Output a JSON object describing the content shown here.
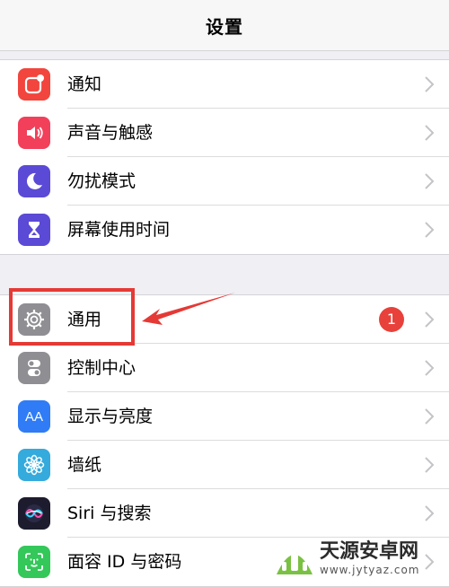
{
  "nav": {
    "title": "设置"
  },
  "group1": [
    {
      "label": "通知",
      "icon": "notification-icon",
      "color": "#f2453d"
    },
    {
      "label": "声音与触感",
      "icon": "speaker-icon",
      "color": "#f2405a"
    },
    {
      "label": "勿扰模式",
      "icon": "moon-icon",
      "color": "#5b4ad6"
    },
    {
      "label": "屏幕使用时间",
      "icon": "hourglass-icon",
      "color": "#5b4ad6"
    }
  ],
  "group2": [
    {
      "label": "通用",
      "icon": "gear-icon",
      "color": "#8e8e93",
      "badge": "1"
    },
    {
      "label": "控制中心",
      "icon": "toggle-icon",
      "color": "#8e8e93"
    },
    {
      "label": "显示与亮度",
      "icon": "text-size-icon",
      "color": "#2f7cf6",
      "icon_text": "AA"
    },
    {
      "label": "墙纸",
      "icon": "flower-icon",
      "color": "#35aadc"
    },
    {
      "label": "Siri 与搜索",
      "icon": "siri-icon",
      "color": "#1c1c2e"
    },
    {
      "label": "面容 ID 与密码",
      "icon": "face-id-icon",
      "color": "#34c759"
    }
  ],
  "annotation": {
    "color": "#e53935"
  },
  "watermark": {
    "main": "天源安卓网",
    "url": "www.jytyaz.com"
  }
}
